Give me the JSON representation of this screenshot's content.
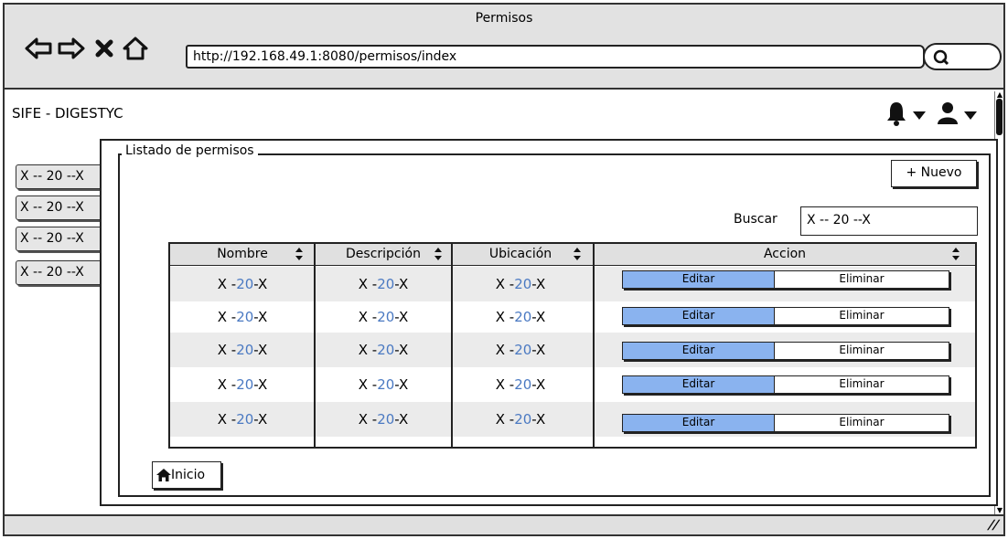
{
  "window": {
    "title": "Permisos",
    "url": "http://192.168.49.1:8080/permisos/index",
    "icons": [
      "back-arrow-icon",
      "forward-arrow-icon",
      "close-x-icon",
      "home-outline-icon",
      "search-icon"
    ]
  },
  "app": {
    "title": "SIFE - DIGESTYC",
    "header_icons": [
      "bell-icon",
      "caret-down-icon",
      "user-icon",
      "caret-down-icon"
    ]
  },
  "sidebar": {
    "items": [
      {
        "label": "X -- 20 --X"
      },
      {
        "label": "X -- 20 --X"
      },
      {
        "label": "X -- 20 --X"
      },
      {
        "label": "X -- 20 --X"
      }
    ]
  },
  "panel": {
    "legend": "Listado de permisos",
    "new_button": "+ Nuevo",
    "search_label": "Buscar",
    "search_value": "X -- 20 --X",
    "home_button": "Inicio"
  },
  "table": {
    "columns": [
      "Nombre",
      "Descripción",
      "Ubicación",
      "Accion"
    ],
    "rows": [
      {
        "nombre": {
          "a": "X -",
          "b": "20",
          "c": "-X"
        },
        "descripcion": {
          "a": "X -",
          "b": "20",
          "c": "-X"
        },
        "ubicacion": {
          "a": "X -",
          "b": "20",
          "c": "-X"
        },
        "edit": "Editar",
        "delete": "Eliminar"
      },
      {
        "nombre": {
          "a": "X -",
          "b": "20",
          "c": "-X"
        },
        "descripcion": {
          "a": "X -",
          "b": "20",
          "c": "-X"
        },
        "ubicacion": {
          "a": "X -",
          "b": "20",
          "c": "-X"
        },
        "edit": "Editar",
        "delete": "Eliminar"
      },
      {
        "nombre": {
          "a": "X -",
          "b": "20",
          "c": "-X"
        },
        "descripcion": {
          "a": "X -",
          "b": "20",
          "c": "-X"
        },
        "ubicacion": {
          "a": "X -",
          "b": "20",
          "c": "-X"
        },
        "edit": "Editar",
        "delete": "Eliminar"
      },
      {
        "nombre": {
          "a": "X -",
          "b": "20",
          "c": "-X"
        },
        "descripcion": {
          "a": "X -",
          "b": "20",
          "c": "-X"
        },
        "ubicacion": {
          "a": "X -",
          "b": "20",
          "c": "-X"
        },
        "edit": "Editar",
        "delete": "Eliminar"
      },
      {
        "nombre": {
          "a": "X -",
          "b": "20",
          "c": "-X"
        },
        "descripcion": {
          "a": "X -",
          "b": "20",
          "c": "-X"
        },
        "ubicacion": {
          "a": "X -",
          "b": "20",
          "c": "-X"
        },
        "edit": "Editar",
        "delete": "Eliminar"
      }
    ]
  },
  "colors": {
    "chrome_bg": "#e2e2e2",
    "edit_button": "#8ab3ef",
    "row_alt": "#ebebeb",
    "data_accent": "#4a79c2"
  }
}
